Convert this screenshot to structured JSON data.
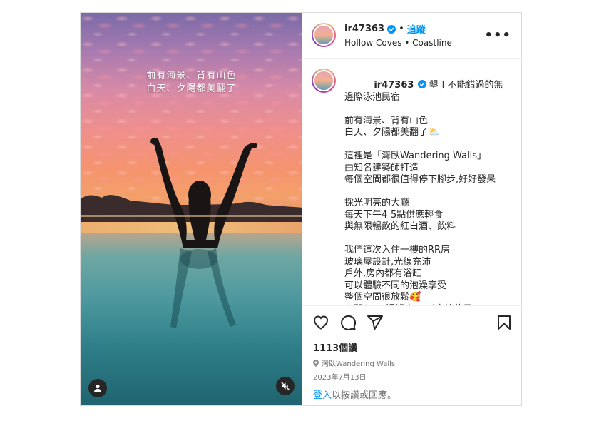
{
  "media": {
    "overlay_line1": "前有海景、背有山色",
    "overlay_line2": "白天、夕陽都美翻了"
  },
  "header": {
    "username": "ir47363",
    "follow_label": "追蹤",
    "location": "Hollow Coves • Coastline"
  },
  "caption": {
    "username": "ir47363",
    "lines": [
      "墾丁不能錯過的無邊際泳池民宿",
      "前有海景、背有山色",
      "白天、夕陽都美翻了⛅",
      "",
      "這裡是「灣臥Wandering Walls」",
      "由知名建築師打造",
      "每個空間都很值得停下腳步,好好發呆",
      "",
      "採光明亮的大廳",
      "每天下午4-5點供應輕食",
      "與無限暢飲的紅白酒、飲料",
      "",
      "我們這次入住一樓的RR房",
      "玻璃屋設計,光線充沛",
      "戶外,房內都有浴缸",
      "可以體驗不同的泡澡享受",
      "整個空間很放鬆🥰",
      "房間有RO過濾水 可以直接飲用"
    ]
  },
  "stats": {
    "likes": "1113個讚",
    "place": "灣臥Wandering Walls",
    "date": "2023年7月13日"
  },
  "footer": {
    "login_link": "登入",
    "login_rest": "以按讚或回應。"
  },
  "colors": {
    "accent": "#0095f6",
    "muted": "#737373",
    "text": "#262626"
  },
  "icons": [
    "verified-icon",
    "more-icon",
    "heart-icon",
    "comment-icon",
    "share-icon",
    "bookmark-icon",
    "user-tag-icon",
    "mute-icon",
    "location-pin-icon"
  ]
}
